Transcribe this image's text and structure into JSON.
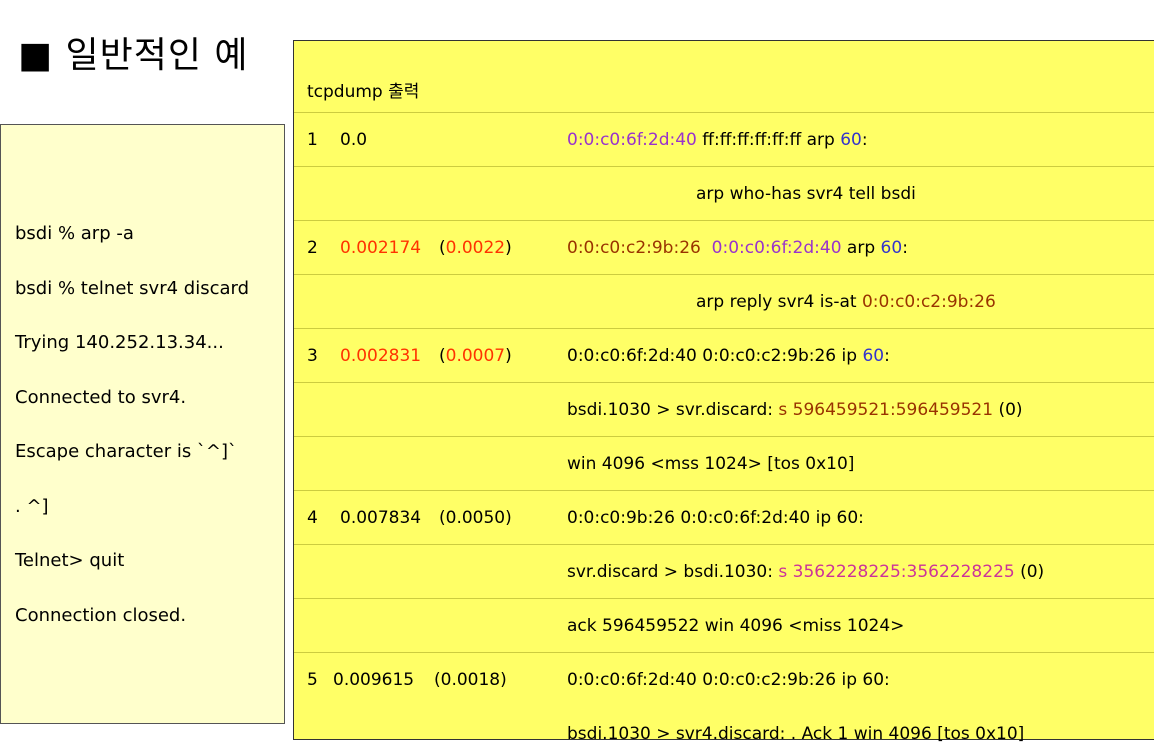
{
  "title": "■ 일반적인 예",
  "terminal": {
    "lines": [
      "bsdi %  arp -a",
      "bsdi % telnet svr4 discard",
      "Trying 140.252.13.34...",
      "Connected to svr4.",
      "Escape character is  `^]`",
      " . ^]",
      "Telnet> quit",
      "Connection closed."
    ]
  },
  "tcpdump": {
    "heading": "tcpdump 출력",
    "r1": {
      "num": "1",
      "time": "0.0",
      "src": "0:0:c0:6f:2d:40",
      "mid": "  ff:ff:ff:ff:ff:ff arp ",
      "len": "60",
      "colon": ":"
    },
    "r1b": "arp who-has svr4 tell bsdi",
    "r2": {
      "num": "2",
      "time": "0.002174",
      "paren_open": "(",
      "delta": "0.0022",
      "paren_close": ")",
      "src": "0:0:c0:c2:9b:26",
      "dst": "0:0:c0:6f:2d:40",
      "proto": " arp ",
      "len": "60",
      "colon": ":"
    },
    "r2b": {
      "text": "arp reply  svr4 is-at ",
      "mac": "0:0:c0:c2:9b:26"
    },
    "r3": {
      "num": "3",
      "time": "0.002831",
      "paren_open": "(",
      "delta": "0.0007",
      "paren_close": ")",
      "addr": "0:0:c0:6f:2d:40  0:0:c0:c2:9b:26 ip ",
      "len": "60",
      "colon": ":"
    },
    "r3b": {
      "text": "bsdi.1030 > svr.discard:  ",
      "seq": "s 596459521:596459521",
      "tail": " (0)"
    },
    "r3c": "win 4096 <mss 1024> [tos 0x10]",
    "r4": {
      "num": "4",
      "time": "0.007834",
      "delta": "(0.0050)",
      "addr": "0:0:c0:9b:26  0:0:c0:6f:2d:40 ip 60:"
    },
    "r4b": {
      "text": "svr.discard > bsdi.1030: ",
      "seq": "s 3562228225:3562228225",
      "tail": " (0)"
    },
    "r4c": "ack 596459522 win 4096 <miss 1024>",
    "r5": {
      "num": "5",
      "time": "0.009615",
      "delta": "(0.0018)",
      "addr": "0:0:c0:6f:2d:40  0:0:c0:c2:9b:26  ip 60:"
    },
    "r5b": "bsdi.1030 > svr4.discard: . Ack 1 win 4096 [tos 0x10]"
  }
}
